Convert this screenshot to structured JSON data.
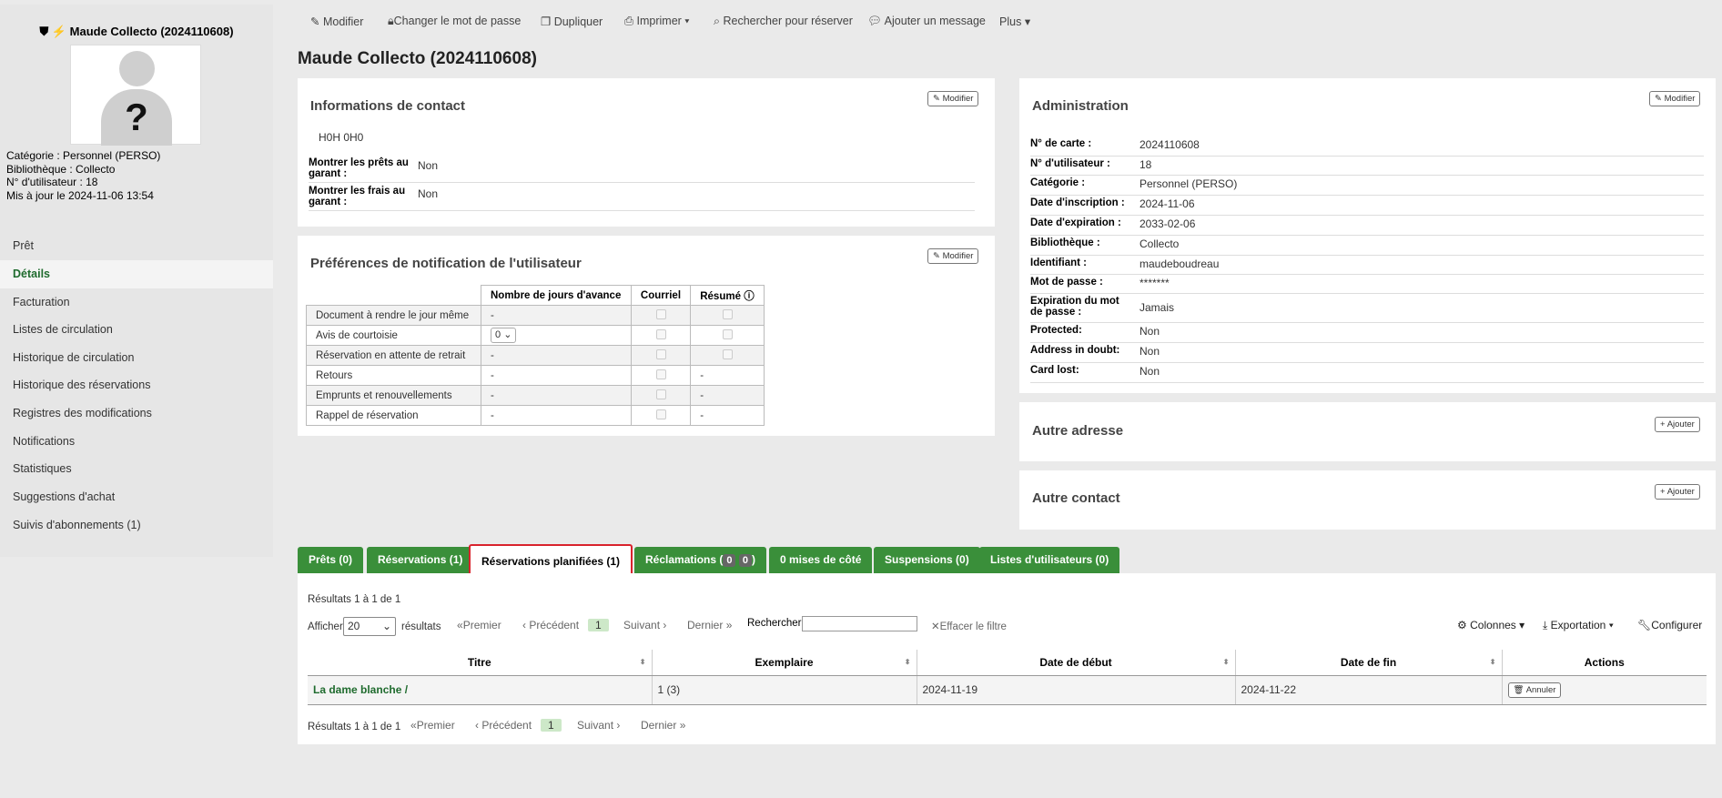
{
  "patron": {
    "header": "Maude Collecto (2024110608)",
    "category": "Catégorie : Personnel (PERSO)",
    "library": "Bibliothèque : Collecto",
    "user_number": "N° d'utilisateur : 18",
    "updated": "Mis à jour le 2024-11-06 13:54",
    "avatar_mark": "?"
  },
  "nav": [
    "Prêt",
    "Détails",
    "Facturation",
    "Listes de circulation",
    "Historique de circulation",
    "Historique des réservations",
    "Registres des modifications",
    "Notifications",
    "Statistiques",
    "Suggestions d'achat",
    "Suivis d'abonnements (1)"
  ],
  "toolbar": {
    "modify": "Modifier",
    "change_password": "Changer le mot de passe",
    "duplicate": "Dupliquer",
    "print": "Imprimer",
    "search_hold": "Rechercher pour réserver",
    "add_message": "Ajouter un message",
    "more": "Plus"
  },
  "page_title": "Maude Collecto (2024110608)",
  "contact": {
    "title": "Informations de contact",
    "edit": "Modifier",
    "address": "H0H 0H0",
    "show_loans_label": "Montrer les prêts au garant :",
    "show_loans_value": "Non",
    "show_fees_label": "Montrer les frais au garant :",
    "show_fees_value": "Non"
  },
  "notif": {
    "title": "Préférences de notification de l'utilisateur",
    "edit": "Modifier",
    "headers": [
      "Nombre de jours d'avance",
      "Courriel",
      "Résumé"
    ],
    "rows": [
      {
        "name": "Document à rendre le jour même",
        "days": "-",
        "summary": "box"
      },
      {
        "name": "Avis de courtoisie",
        "days": "0",
        "summary": "box"
      },
      {
        "name": "Réservation en attente de retrait",
        "days": "-",
        "summary": "box"
      },
      {
        "name": "Retours",
        "days": "-",
        "summary": "-"
      },
      {
        "name": "Emprunts et renouvellements",
        "days": "-",
        "summary": "-"
      },
      {
        "name": "Rappel de réservation",
        "days": "-",
        "summary": "-"
      }
    ]
  },
  "admin": {
    "title": "Administration",
    "edit": "Modifier",
    "fields": [
      {
        "label": "N° de carte :",
        "value": "2024110608"
      },
      {
        "label": "N° d'utilisateur :",
        "value": "18"
      },
      {
        "label": "Catégorie :",
        "value": "Personnel (PERSO)"
      },
      {
        "label": "Date d'inscription :",
        "value": "2024-11-06"
      },
      {
        "label": "Date d'expiration :",
        "value": "2033-02-06"
      },
      {
        "label": "Bibliothèque :",
        "value": "Collecto"
      },
      {
        "label": "Identifiant :",
        "value": "maudeboudreau"
      },
      {
        "label": "Mot de passe :",
        "value": "*******"
      },
      {
        "label": "Expiration du mot de passe :",
        "value": "Jamais"
      },
      {
        "label": "Protected:",
        "value": "Non"
      },
      {
        "label": "Address in doubt:",
        "value": "Non"
      },
      {
        "label": "Card lost:",
        "value": "Non"
      }
    ]
  },
  "alt_address": {
    "title": "Autre adresse",
    "add": "Ajouter"
  },
  "alt_contact": {
    "title": "Autre contact",
    "add": "Ajouter"
  },
  "tabs": {
    "loans": "Prêts (0)",
    "holds": "Réservations (1)",
    "scheduled": "Réservations planifiées (1)",
    "claims": "Réclamations (",
    "claims_b1": "0",
    "claims_b2": "0",
    "claims_end": ")",
    "set_aside": "0 mises de côté",
    "restrictions": "Suspensions (0)",
    "lists": "Listes d'utilisateurs (0)"
  },
  "results": {
    "info": "Résultats 1 à 1 de 1",
    "show": "Afficher",
    "per_page": "20",
    "results_word": "résultats",
    "first": "Premier",
    "prev": "Précédent",
    "page": "1",
    "next": "Suivant",
    "last": "Dernier",
    "search_label": "Rechercher :",
    "clear": "Effacer le filtre",
    "columns": "Colonnes",
    "export": "Exportation",
    "configure": "Configurer",
    "headers": [
      "Titre",
      "Exemplaire",
      "Date de début",
      "Date de fin",
      "Actions"
    ],
    "row": {
      "title": "La dame blanche /",
      "item": "1 (3)",
      "start": "2024-11-19",
      "end": "2024-11-22",
      "cancel": "Annuler"
    }
  },
  "colors": {
    "green": "#3a8f3a",
    "link": "#1f6b2e",
    "active_outline": "#d9232d"
  }
}
